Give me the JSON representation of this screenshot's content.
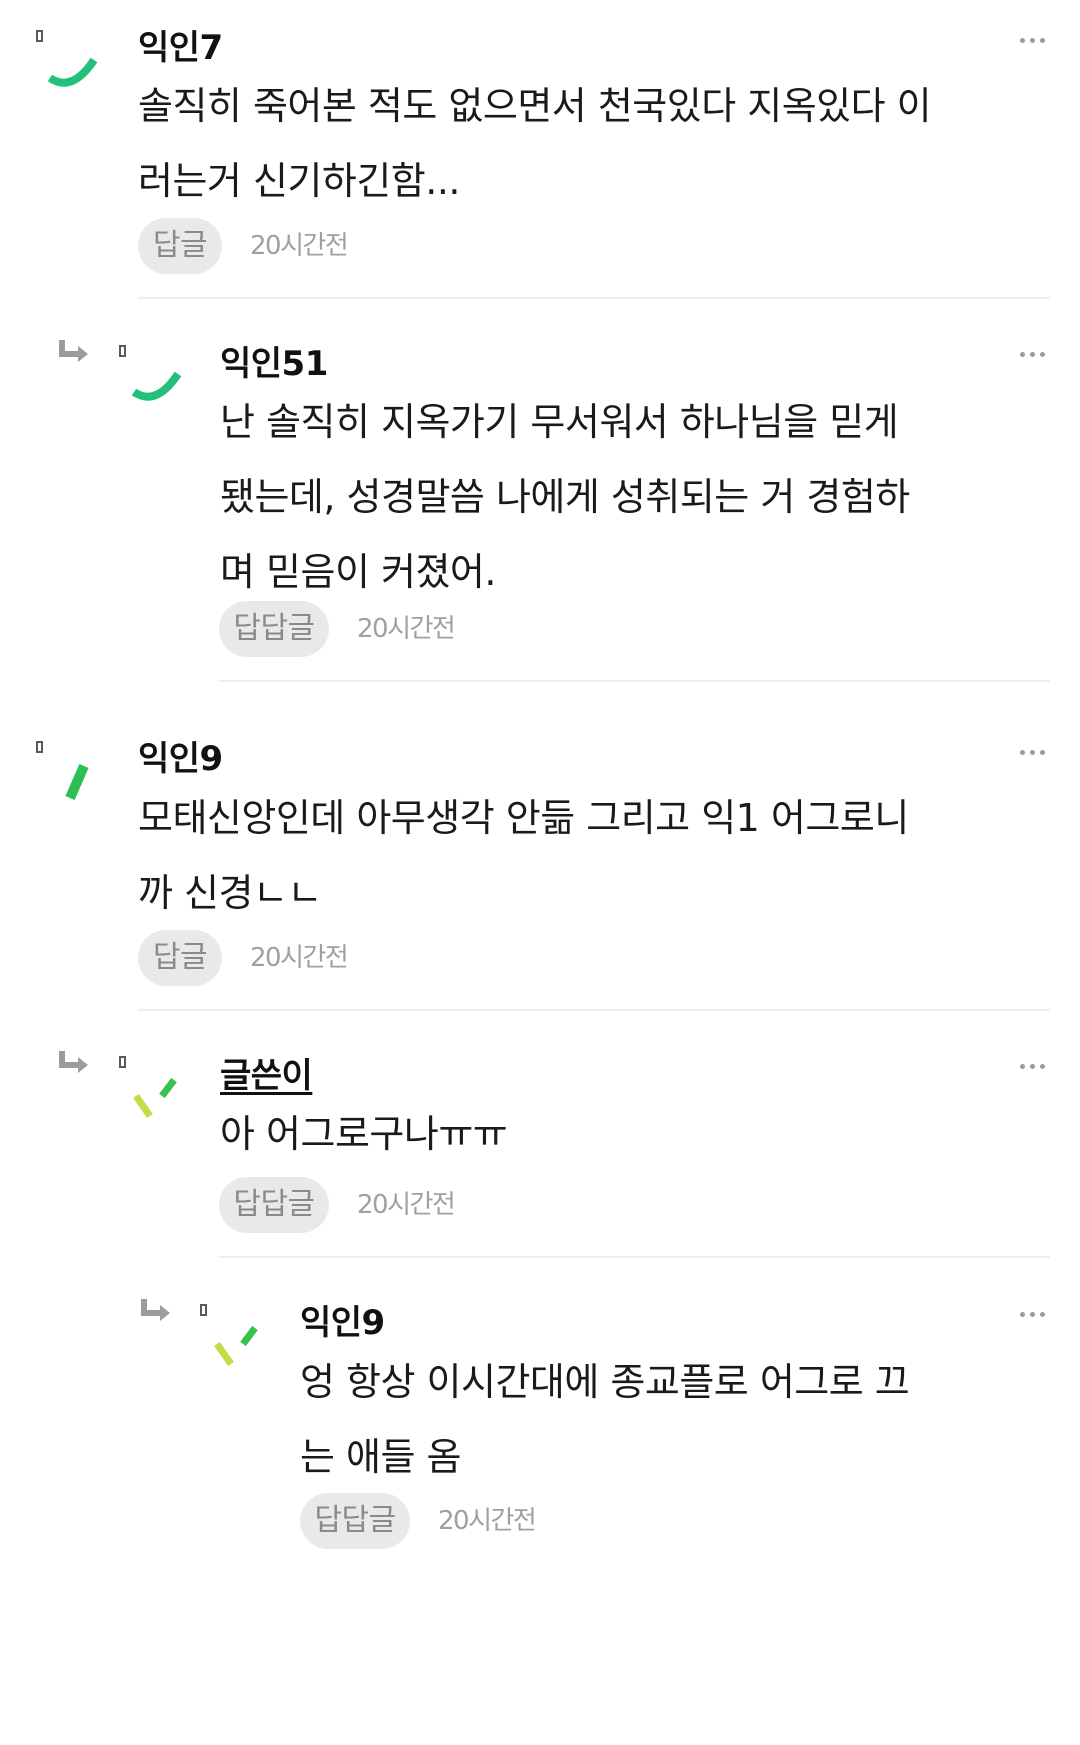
{
  "colors": {
    "avatar_green": "#22c07a",
    "avatar_lime": "#c8d94a",
    "avatar_bright_green": "#3bc24a",
    "reply_button_bg": "#e9e9e9",
    "timestamp": "#a0a0a0"
  },
  "comments": [
    {
      "nickname": "익인7",
      "body": "솔직히 죽어본 적도 없으면서 천국있다 지옥있다 이러는거 신기하긴함...",
      "reply_label": "답글",
      "time": "20시간전",
      "avatar_icon": "green-arc-icon"
    },
    {
      "nickname": "익인51",
      "body": "난 솔직히 지옥가기 무서워서 하나님을 믿게 됐는데, 성경말씀 나에게 성취되는 거 경험하며 믿음이 커졌어.",
      "reply_label": "답답글",
      "time": "20시간전",
      "avatar_icon": "green-arc-icon"
    },
    {
      "nickname": "익인9",
      "body": "모태신앙인데 아무생각 안듦 그리고 익1 어그로니까 신경ㄴㄴ",
      "reply_label": "답글",
      "time": "20시간전",
      "avatar_icon": "green-slash-icon"
    },
    {
      "nickname": "글쓴이",
      "body": "아 어그로구나ㅠㅠ",
      "reply_label": "답답글",
      "time": "20시간전",
      "avatar_icon": "lime-checks-icon"
    },
    {
      "nickname": "익인9",
      "body": "엉 항상 이시간대에 종교플로 어그로 끄는 애들 옴",
      "reply_label": "답답글",
      "time": "20시간전",
      "avatar_icon": "lime-checks-icon"
    }
  ]
}
